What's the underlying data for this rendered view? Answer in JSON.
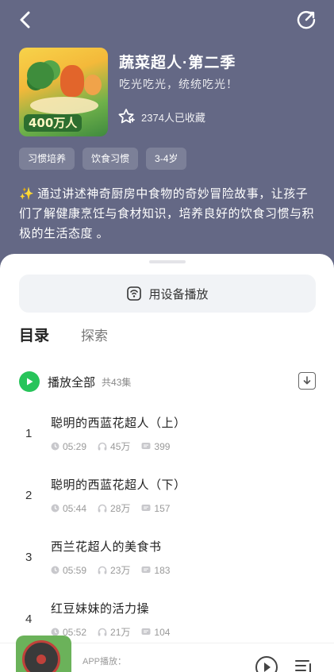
{
  "header": {
    "title": "蔬菜超人·第二季",
    "subtitle": "吃光吃光，统统吃光！",
    "favorites": "2374人已收藏",
    "cover_badge": "400万人",
    "tags": [
      "习惯培养",
      "饮食习惯",
      "3-4岁"
    ],
    "description": "通过讲述神奇厨房中食物的奇妙冒险故事，让孩子们了解健康烹饪与食材知识，培养良好的饮食习惯与积极的生活态度 。"
  },
  "device_button": {
    "label": "用设备播放"
  },
  "tabs": [
    {
      "label": "目录",
      "active": true
    },
    {
      "label": "探索",
      "active": false
    }
  ],
  "play_all": {
    "label": "播放全部",
    "count": "共43集"
  },
  "episodes": [
    {
      "num": "1",
      "title": "聪明的西蓝花超人（上）",
      "duration": "05:29",
      "plays": "45万",
      "comments": "399"
    },
    {
      "num": "2",
      "title": "聪明的西蓝花超人（下）",
      "duration": "05:44",
      "plays": "28万",
      "comments": "157"
    },
    {
      "num": "3",
      "title": "西兰花超人的美食书",
      "duration": "05:59",
      "plays": "23万",
      "comments": "183"
    },
    {
      "num": "4",
      "title": "红豆妹妹的活力操",
      "duration": "05:52",
      "plays": "21万",
      "comments": "104"
    }
  ],
  "player": {
    "label": "APP播放："
  },
  "colors": {
    "header_bg": "#646885",
    "accent_green": "#27c45a",
    "sheet_bg": "#ffffff"
  }
}
